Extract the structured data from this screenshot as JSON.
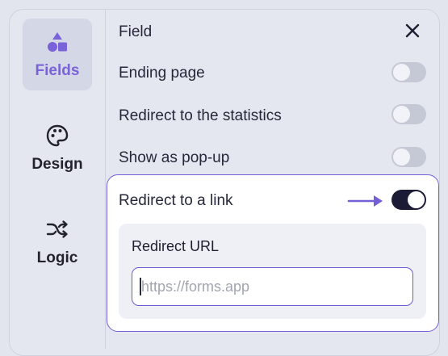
{
  "sidebar": {
    "items": [
      {
        "label": "Fields",
        "icon": "shapes-icon",
        "active": true
      },
      {
        "label": "Design",
        "icon": "palette-icon",
        "active": false
      },
      {
        "label": "Logic",
        "icon": "shuffle-icon",
        "active": false
      }
    ]
  },
  "header": {
    "title": "Field",
    "close_icon": "close-icon"
  },
  "settings": [
    {
      "label": "Ending page",
      "enabled": false
    },
    {
      "label": "Redirect to the statistics",
      "enabled": false
    },
    {
      "label": "Show as pop-up",
      "enabled": false
    },
    {
      "label": "Redirect to a link",
      "enabled": true
    }
  ],
  "redirect": {
    "url_label": "Redirect URL",
    "url_value": "",
    "url_placeholder": "https://forms.app"
  },
  "colors": {
    "accent": "#7a62d8",
    "toggle_on": "#1c1b35",
    "toggle_off": "#c5c9d6",
    "background": "#e5e7f0"
  }
}
